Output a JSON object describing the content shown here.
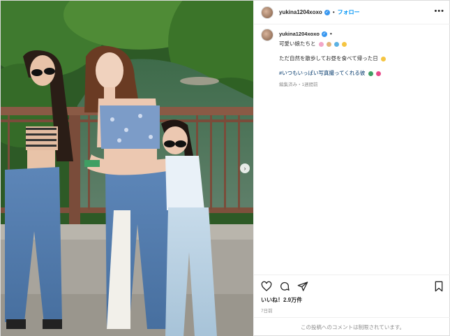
{
  "header": {
    "username": "yukina1204xoxo",
    "separator": "•",
    "follow_label": "フォロー",
    "more_label": "•••"
  },
  "caption": {
    "username": "yukina1204xoxo",
    "line1": "可愛い娘たちと",
    "line2": "ただ自然を散歩してお昼を食べて帰った日",
    "hashtag": "#いつもいっぱい写真撮ってくれる彼",
    "meta": "編集済み・1週間前"
  },
  "actions": {
    "likes": "いいね！2.9万件",
    "time": "7日前"
  },
  "footer": {
    "comments_disabled": "この投稿へのコメントは制限されています。"
  },
  "icons": {
    "like": "heart-icon",
    "comment": "comment-icon",
    "share": "share-icon",
    "save": "bookmark-icon",
    "next": "chevron-right-icon",
    "verified": "verified-badge-icon"
  },
  "colors": {
    "follow": "#0095f6",
    "hashtag": "#00376b",
    "verified": "#3897f0",
    "muted": "#8e8e8e"
  }
}
